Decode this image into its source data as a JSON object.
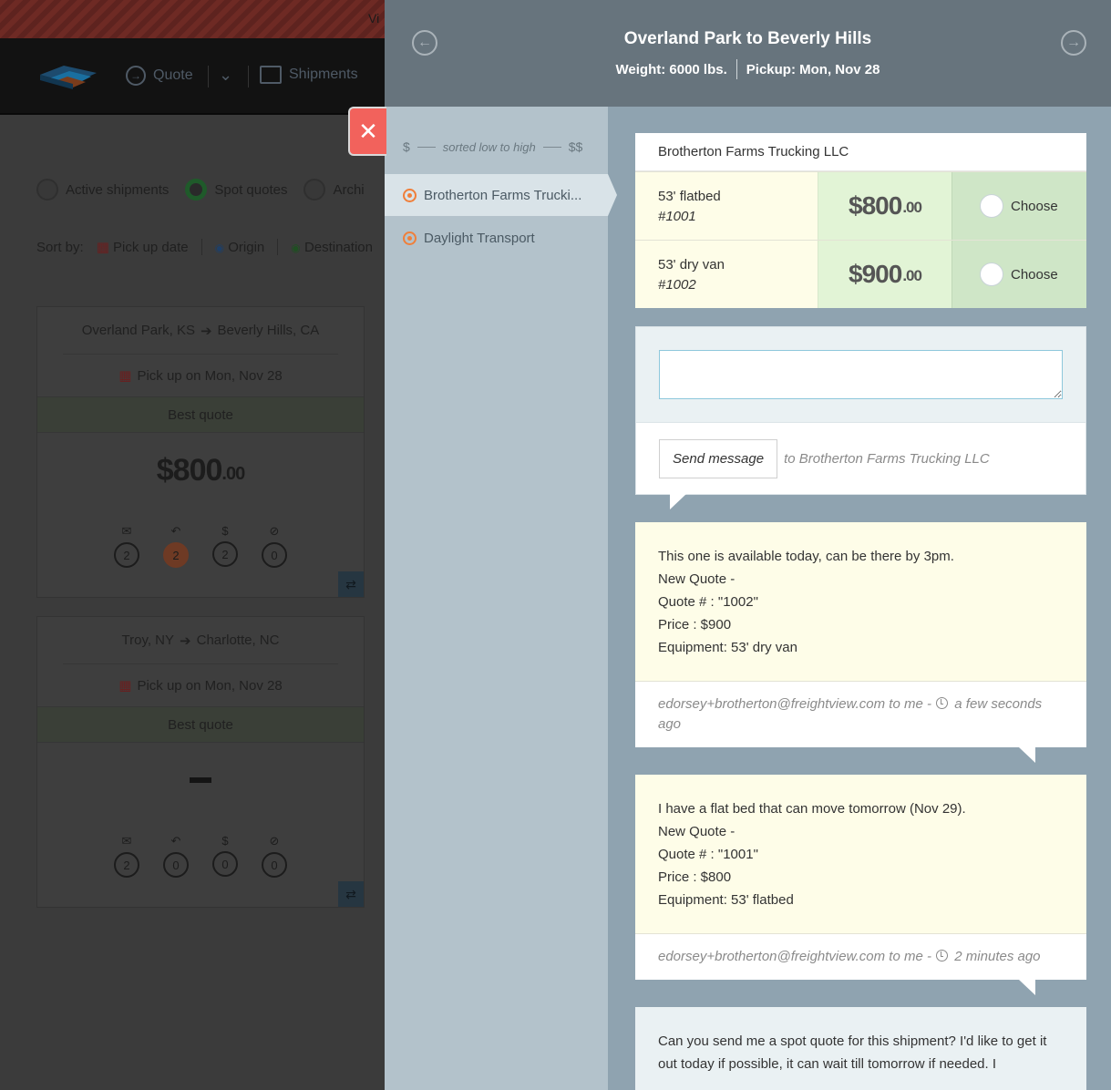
{
  "background": {
    "banner_text": "Vi",
    "nav": {
      "quote": "Quote",
      "shipments": "Shipments"
    },
    "filters": [
      "Active shipments",
      "Spot quotes",
      "Archi"
    ],
    "sort": {
      "label": "Sort by:",
      "options": [
        "Pick up date",
        "Origin",
        "Destination"
      ]
    },
    "cards": [
      {
        "origin": "Overland Park, KS",
        "destination": "Beverly Hills, CA",
        "pickup": "Pick up on Mon, Nov 28",
        "best_label": "Best quote",
        "price_main": "$800",
        "price_cents": ".00",
        "counts": [
          "2",
          "2",
          "2",
          "0"
        ]
      },
      {
        "origin": "Troy, NY",
        "destination": "Charlotte, NC",
        "pickup": "Pick up on Mon, Nov 28",
        "best_label": "Best quote",
        "price_main": "",
        "price_cents": "",
        "counts": [
          "2",
          "0",
          "0",
          "0"
        ]
      }
    ]
  },
  "modal": {
    "title": "Overland Park to Beverly Hills",
    "weight": "Weight: 6000 lbs.",
    "pickup": "Pickup: Mon, Nov 28",
    "sort_hint": {
      "low": "$",
      "text": "sorted low to high",
      "high": "$$"
    },
    "carriers": [
      "Brotherton Farms Trucki...",
      "Daylight Transport"
    ],
    "quote_table": {
      "carrier": "Brotherton Farms Trucking LLC",
      "rows": [
        {
          "equipment": "53' flatbed",
          "number": "#1001",
          "price_main": "$800",
          "price_cents": ".00",
          "choose": "Choose"
        },
        {
          "equipment": "53' dry van",
          "number": "#1002",
          "price_main": "$900",
          "price_cents": ".00",
          "choose": "Choose"
        }
      ]
    },
    "compose": {
      "textarea_value": "",
      "send_label": "Send message",
      "to_text": "to Brotherton Farms Trucking LLC"
    },
    "messages": [
      {
        "lines": [
          "This one is available today, can be there by 3pm.",
          "New Quote -",
          "Quote # : \"1002\"",
          "Price : $900",
          "Equipment: 53' dry van"
        ],
        "from": "edorsey+brotherton@freightview.com to me -",
        "time": "a few seconds ago"
      },
      {
        "lines": [
          "I have a flat bed that can move tomorrow (Nov 29).",
          "New Quote -",
          "Quote # : \"1001\"",
          "Price : $800",
          "Equipment: 53' flatbed"
        ],
        "from": "edorsey+brotherton@freightview.com to me -",
        "time": "2 minutes ago"
      },
      {
        "lines": [
          "Can you send me a spot quote for this shipment? I'd like to get it out today if possible, it can wait till tomorrow if needed. I"
        ]
      }
    ]
  }
}
